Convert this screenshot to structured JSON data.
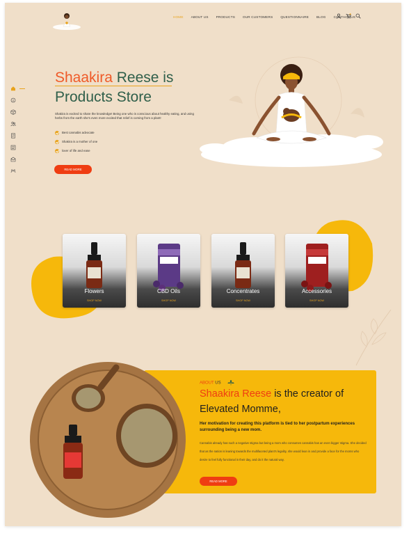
{
  "header": {
    "logo_icon": "mother-baby-logo",
    "nav": [
      {
        "label": "HOME",
        "active": true
      },
      {
        "label": "ABOUT US",
        "active": false
      },
      {
        "label": "PRODUCTS",
        "active": false
      },
      {
        "label": "OUR CUSTOMERS",
        "active": false
      },
      {
        "label": "QUESTIONNAIRE",
        "active": false
      },
      {
        "label": "BLOG",
        "active": false
      },
      {
        "label": "CONTACT US",
        "active": false
      }
    ],
    "icons": [
      "user-icon",
      "cart-icon",
      "search-icon"
    ]
  },
  "sidebar": {
    "icons": [
      "home-icon",
      "info-icon",
      "products-icon",
      "customers-icon",
      "questionnaire-icon",
      "blog-icon",
      "contact-icon",
      "testimonials-icon"
    ]
  },
  "hero": {
    "title_part1": "Shaakira",
    "title_part2": " Reese is",
    "title_line2": "Products Store",
    "description": "Shakira is excited to share the knowledge! Being one who is conscious about healthy eating, and using herbs from the earth she's even more excited that relief is coming from a plant!",
    "list": [
      "Best cannabis advocate",
      "Shakira is a mother of one",
      "lover of life and ease"
    ],
    "button_label": "READ MORE"
  },
  "products": [
    {
      "title": "Flowers",
      "shop_label": "SHOP NOW"
    },
    {
      "title": "CBD Oils",
      "shop_label": "SHOP NOW"
    },
    {
      "title": "Concentrates",
      "shop_label": "SHOP NOW"
    },
    {
      "title": "Accessories",
      "shop_label": "SHOP NOW"
    }
  ],
  "about": {
    "kicker_orange": "ABOUT",
    "kicker_dark": " US",
    "title_orange": "Shaakira Reese",
    "title_rest": " is the creator of Elevated Momme,",
    "subtitle": "Her motivation for creating this platform is tied to her postpartum experiences surrounding being a new mom.",
    "body": "Cannabis already has such a negative stigma but being a mom who consumes cannabis has an even bigger stigma. She decided that as the nation is leaning towards the multifaceted plant's legality, she would lean in and provide a face for the moms who desire to feel fully functional in their day, and do it the natural way.",
    "button_label": "READ MORE"
  },
  "colors": {
    "background": "#f0dfc9",
    "accent_orange": "#ef3d12",
    "accent_yellow": "#f6b80b",
    "heading_green": "#2f5f4a"
  }
}
